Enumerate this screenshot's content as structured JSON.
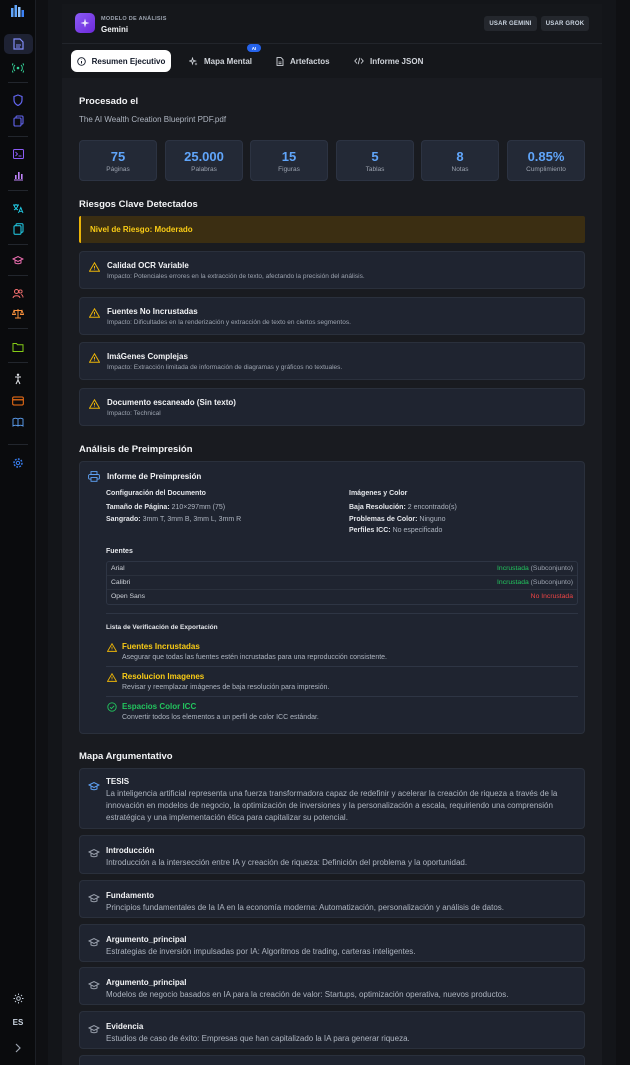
{
  "header": {
    "model_caption": "MODELO DE ANÁLISIS",
    "model_name": "Gemini",
    "btn_gemini": "USAR GEMINI",
    "btn_grok": "USAR GROK"
  },
  "tabs": [
    {
      "label": "Resumen Ejecutivo",
      "icon": "info-icon",
      "active": true
    },
    {
      "label": "Mapa Mental",
      "icon": "sparkles-icon",
      "badge": "AI"
    },
    {
      "label": "Artefactos",
      "icon": "file-icon"
    },
    {
      "label": "Informe JSON",
      "icon": "code-icon"
    }
  ],
  "processed": {
    "title": "Procesado el",
    "filename": "The AI Wealth Creation Blueprint PDF.pdf"
  },
  "stats": [
    {
      "value": "75",
      "label": "Páginas"
    },
    {
      "value": "25.000",
      "label": "Palabras"
    },
    {
      "value": "15",
      "label": "Figuras"
    },
    {
      "value": "5",
      "label": "Tablas"
    },
    {
      "value": "8",
      "label": "Notas"
    },
    {
      "value": "0.85%",
      "label": "Cumplimiento"
    }
  ],
  "risks": {
    "title": "Riesgos Clave Detectados",
    "level": "Nivel de Riesgo: Moderado",
    "impact_label": "Impacto:",
    "items": [
      {
        "title": "Calidad OCR Variable",
        "impact": "Potenciales errores en la extracción de texto, afectando la precisión del análisis."
      },
      {
        "title": "Fuentes No Incrustadas",
        "impact": "Dificultades en la renderización y extracción de texto en ciertos segmentos."
      },
      {
        "title": "ImáGenes Complejas",
        "impact": "Extracción limitada de información de diagramas y gráficos no textuales."
      },
      {
        "title": "Documento escaneado (Sin texto)",
        "impact": "Technical"
      }
    ]
  },
  "preprint": {
    "section_title": "Análisis de Preimpresión",
    "card_title": "Informe de Preimpresión",
    "config_title": "Configuración del Documento",
    "page_size_label": "Tamaño de Página:",
    "page_size": "210×297mm (75)",
    "bleed_label": "Sangrado:",
    "bleed": "3mm T, 3mm B, 3mm L, 3mm R",
    "images_title": "Imágenes y Color",
    "low_res_label": "Baja Resolución:",
    "low_res": "2 encontrado(s)",
    "color_label": "Problemas de Color:",
    "color": "Ninguno",
    "icc_label": "Perfiles ICC:",
    "icc": "No especificado",
    "fonts_title": "Fuentes",
    "fonts": [
      {
        "name": "Arial",
        "status": "Incrustada",
        "extra": "(Subconjunto)"
      },
      {
        "name": "Calibri",
        "status": "Incrustada",
        "extra": "(Subconjunto)"
      },
      {
        "name": "Open Sans",
        "status": "No Incrustada",
        "extra": ""
      }
    ],
    "checklist_title": "Lista de Verificación de Exportación",
    "checklist": [
      {
        "title": "Fuentes Incrustadas",
        "desc": "Asegurar que todas las fuentes estén incrustadas para una reproducción consistente.",
        "state": "warning",
        "color": "#facc15"
      },
      {
        "title": "Resolucion Imagenes",
        "desc": "Revisar y reemplazar imágenes de baja resolución para impresión.",
        "state": "warning",
        "color": "#facc15"
      },
      {
        "title": "Espacios Color ICC",
        "desc": "Convertir todos los elementos a un perfil de color ICC estándar.",
        "state": "ok",
        "color": "#22c55e"
      }
    ]
  },
  "argument_map": {
    "title": "Mapa Argumentativo",
    "items": [
      {
        "label": "TESIS",
        "text": "La inteligencia artificial representa una fuerza transformadora capaz de redefinir y acelerar la creación de riqueza a través de la innovación en modelos de negocio, la optimización de inversiones y la personalización a escala, requiriendo una comprensión estratégica y una implementación ética para capitalizar su potencial."
      },
      {
        "label": "Introducción",
        "text": "Introducción a la intersección entre IA y creación de riqueza: Definición del problema y la oportunidad."
      },
      {
        "label": "Fundamento",
        "text": "Principios fundamentales de la IA en la economía moderna: Automatización, personalización y análisis de datos."
      },
      {
        "label": "Argumento_principal",
        "text": "Estrategias de inversión impulsadas por IA: Algoritmos de trading, carteras inteligentes."
      },
      {
        "label": "Argumento_principal",
        "text": "Modelos de negocio basados en IA para la creación de valor: Startups, optimización operativa, nuevos productos."
      },
      {
        "label": "Evidencia",
        "text": "Estudios de caso de éxito: Empresas que han capitalizado la IA para generar riqueza."
      }
    ]
  },
  "sidebar": {
    "language": "ES",
    "icons": [
      "file-icon",
      "broadcast-icon",
      "shield-icon",
      "copy-icon",
      "terminal-icon",
      "bar-chart-icon",
      "translate-icon",
      "documents-icon",
      "graduation-cap-icon",
      "users-icon",
      "scales-icon",
      "folder-icon",
      "accessibility-icon",
      "card-icon",
      "book-icon",
      "settings-icon",
      "sun-icon",
      "chevron-right-icon"
    ]
  },
  "colors": {
    "accent": "#60a5fa",
    "warning": "#facc15",
    "success": "#22c55e",
    "danger": "#ef4444",
    "brand": "#8b5cf6"
  }
}
